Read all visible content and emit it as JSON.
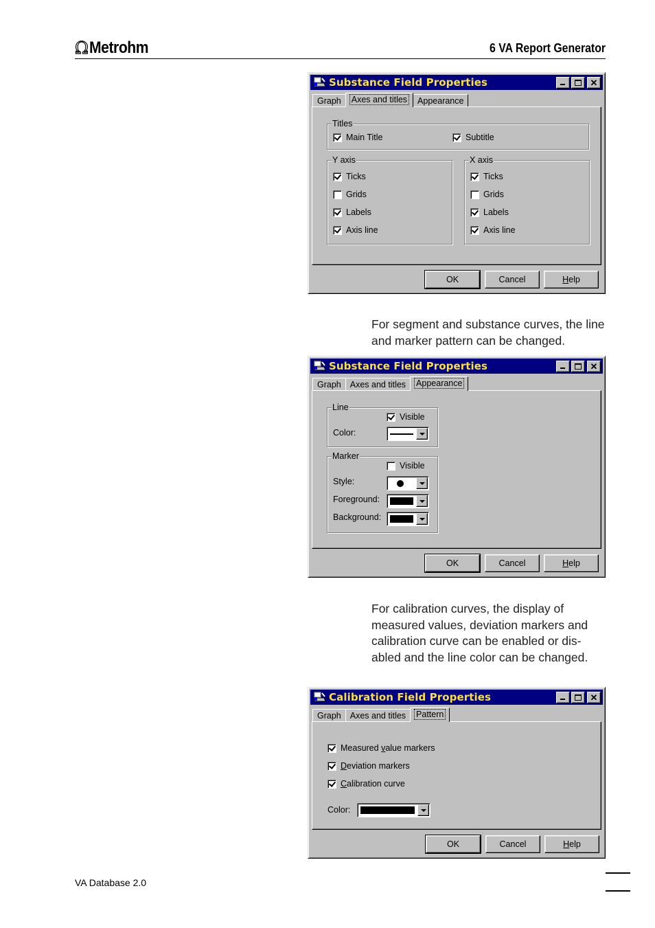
{
  "header": {
    "logo_symbol": "Ω",
    "logo_text": "Metrohm",
    "chapter_title": "6  VA Report Generator"
  },
  "paragraphs": {
    "segment_curves": "For segment and substance curves, the line and marker pattern can be changed.",
    "calibration_curves": "For calibration curves, the display of measured values, deviation markers and calibration curve can be enabled or dis-abled and the line color can be changed."
  },
  "footer": {
    "product": "VA Database 2.0"
  },
  "dialog1": {
    "title": "Substance Field Properties",
    "app_icon": "printer-app-icon",
    "tabs": [
      {
        "label": "Graph",
        "active": false
      },
      {
        "label": "Axes and titles",
        "active": true
      },
      {
        "label": "Appearance",
        "active": false
      }
    ],
    "titles_group": {
      "label": "Titles",
      "items": [
        {
          "label": "Main Title",
          "checked": true
        },
        {
          "label": "Subtitle",
          "checked": true
        }
      ]
    },
    "y_axis_group": {
      "label": "Y axis",
      "items": [
        {
          "label": "Ticks",
          "checked": true
        },
        {
          "label": "Grids",
          "checked": false
        },
        {
          "label": "Labels",
          "checked": true
        },
        {
          "label": "Axis line",
          "checked": true
        }
      ]
    },
    "x_axis_group": {
      "label": "X axis",
      "items": [
        {
          "label": "Ticks",
          "checked": true
        },
        {
          "label": "Grids",
          "checked": false
        },
        {
          "label": "Labels",
          "checked": true
        },
        {
          "label": "Axis line",
          "checked": true
        }
      ]
    },
    "buttons": {
      "ok": "OK",
      "cancel": "Cancel",
      "help_prefix": "H",
      "help_rest": "elp"
    }
  },
  "dialog2": {
    "title": "Substance Field Properties",
    "tabs": [
      {
        "label": "Graph",
        "active": false
      },
      {
        "label": "Axes and titles",
        "active": false
      },
      {
        "label": "Appearance",
        "active": true
      }
    ],
    "line_group": {
      "label": "Line",
      "visible_label": "Visible",
      "visible_checked": true,
      "color_label": "Color:",
      "color_value": "solid-line"
    },
    "marker_group": {
      "label": "Marker",
      "visible_label": "Visible",
      "visible_checked": false,
      "style_label": "Style:",
      "style_value": "filled-circle",
      "foreground_label": "Foreground:",
      "foreground_color": "#000000",
      "background_label": "Background:",
      "background_color": "#000000"
    },
    "buttons": {
      "ok": "OK",
      "cancel": "Cancel",
      "help_prefix": "H",
      "help_rest": "elp"
    }
  },
  "dialog3": {
    "title": "Calibration Field Properties",
    "tabs": [
      {
        "label": "Graph",
        "active": false
      },
      {
        "label": "Axes and titles",
        "active": false
      },
      {
        "label": "Pattern",
        "active": true
      }
    ],
    "options": [
      {
        "pre": "Measured ",
        "accel": "v",
        "post": "alue markers",
        "checked": true
      },
      {
        "pre": "",
        "accel": "D",
        "post": "eviation markers",
        "checked": true
      },
      {
        "pre": "",
        "accel": "C",
        "post": "alibration curve",
        "checked": true
      }
    ],
    "color_label": "Color:",
    "color_value": "#000000",
    "buttons": {
      "ok": "OK",
      "cancel": "Cancel",
      "help_prefix": "H",
      "help_rest": "elp"
    }
  },
  "colors": {
    "titlebar_bg": "#000080",
    "titlebar_text": "#f8e040",
    "dialog_face": "#c0c0c0"
  }
}
